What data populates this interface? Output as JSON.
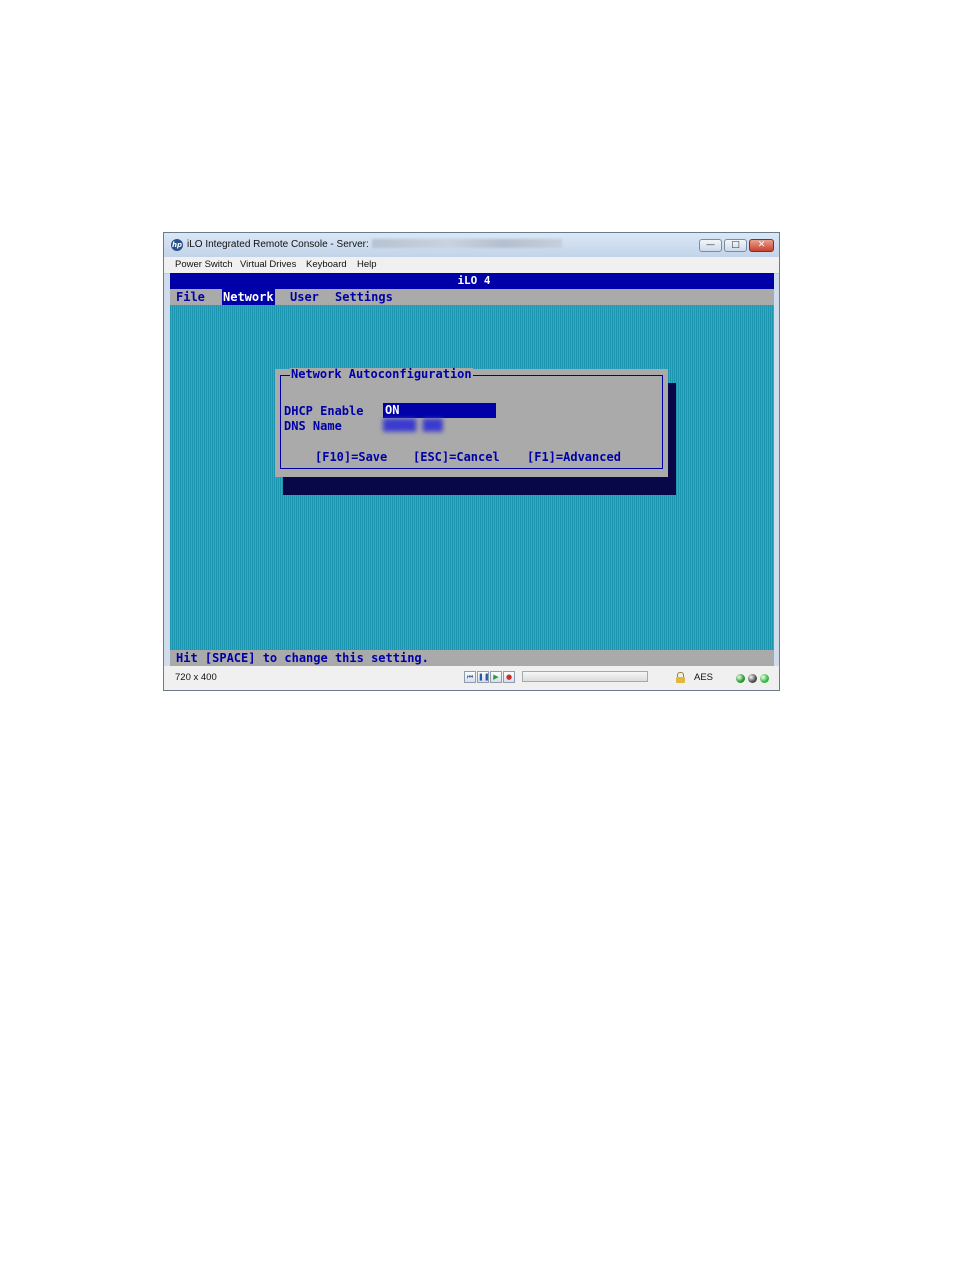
{
  "window": {
    "title": "iLO Integrated Remote Console - Server:"
  },
  "menubar": {
    "items": [
      "Power Switch",
      "Virtual Drives",
      "Keyboard",
      "Help"
    ]
  },
  "console": {
    "header": "iLO 4",
    "menu": [
      "File",
      "Network",
      "User",
      "Settings"
    ],
    "active_menu": "Network",
    "dialog": {
      "title": "Network Autoconfiguration",
      "fields": [
        {
          "label": "DHCP Enable",
          "value": "ON"
        },
        {
          "label": "DNS Name"
        }
      ],
      "keys": [
        "[F10]=Save",
        "[ESC]=Cancel",
        "[F1]=Advanced"
      ]
    },
    "status_line": "Hit [SPACE] to change this setting."
  },
  "statusbar": {
    "resolution": "720 x 400",
    "encryption": "AES",
    "led_colors": [
      "#1f9a2a",
      "#4a4a4a",
      "#2fb83a"
    ]
  }
}
